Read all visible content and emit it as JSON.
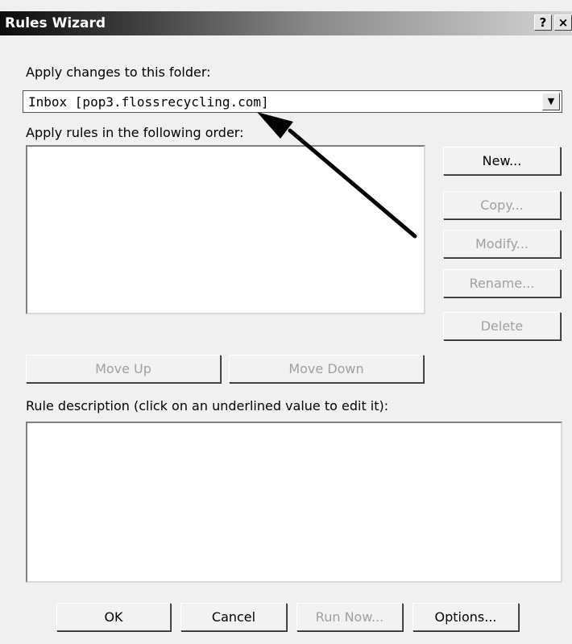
{
  "window": {
    "title": "Rules Wizard"
  },
  "titlebar": {
    "help_label": "?",
    "close_label": "×"
  },
  "folder": {
    "label": "Apply changes to this folder:",
    "selected": "Inbox [pop3.flossrecycling.com]",
    "dropdown_icon": "chevron-down-icon"
  },
  "rules": {
    "label": "Apply rules in the following order:",
    "items": []
  },
  "side_buttons": {
    "new": "New...",
    "copy": "Copy...",
    "modify": "Modify...",
    "rename": "Rename...",
    "delete": "Delete"
  },
  "move": {
    "up": "Move Up",
    "down": "Move Down"
  },
  "description": {
    "label": "Rule description (click on an underlined value to edit it):"
  },
  "footer": {
    "ok": "OK",
    "cancel": "Cancel",
    "run_now": "Run Now...",
    "options": "Options..."
  },
  "annotation": {
    "arrow_color": "#000000"
  }
}
